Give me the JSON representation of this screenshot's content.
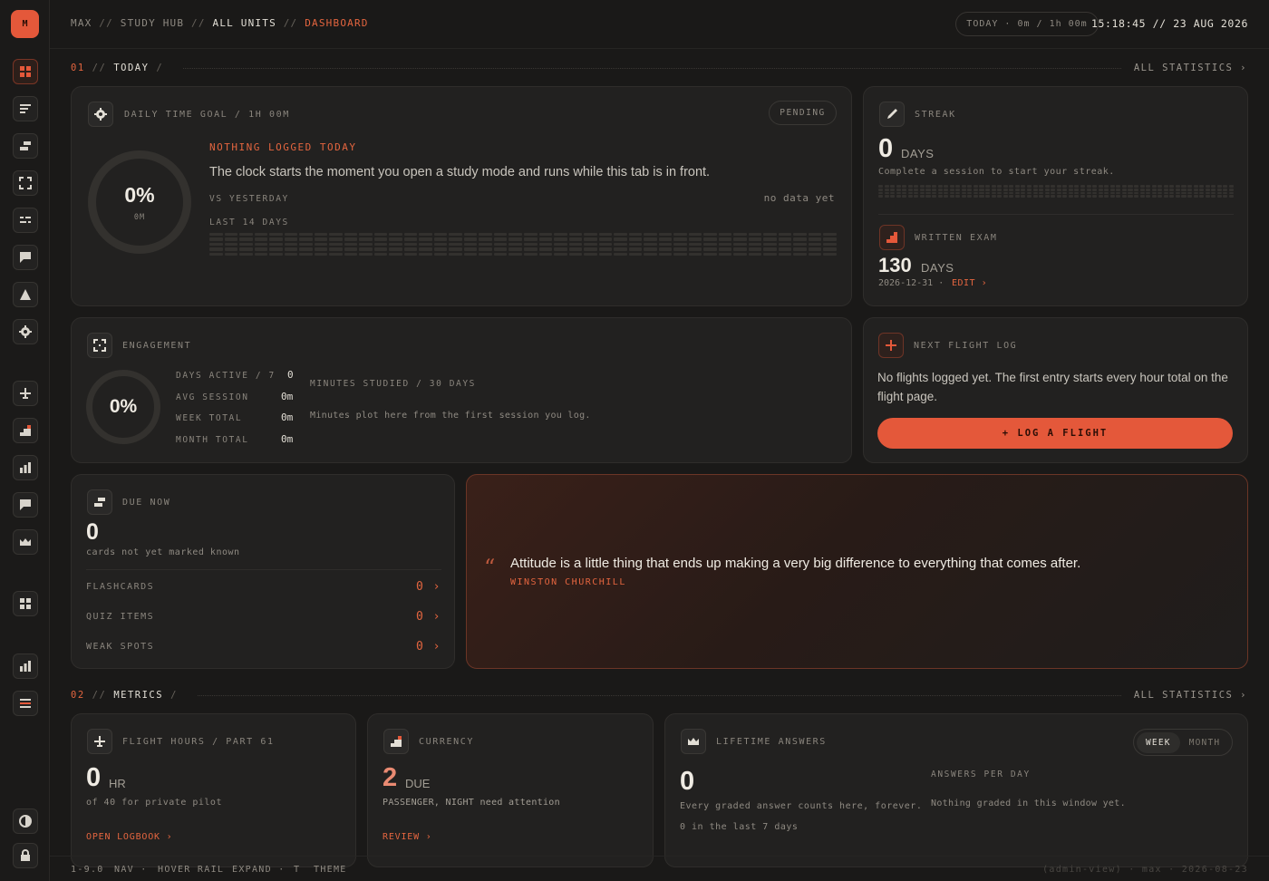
{
  "app": {
    "logo": "M"
  },
  "breadcrumb": {
    "user": "MAX",
    "hub": "STUDY HUB",
    "units": "ALL UNITS",
    "current": "DASHBOARD",
    "sep": "//"
  },
  "topbar": {
    "today_pill": "TODAY · 0m / 1h 00m",
    "clock": "15:18:45 // 23 AUG 2026"
  },
  "sections": {
    "today": {
      "num": "01",
      "title": "TODAY",
      "all": "ALL STATISTICS ›"
    },
    "metrics": {
      "num": "02",
      "title": "METRICS",
      "all": "ALL STATISTICS ›"
    }
  },
  "goal": {
    "label": "DAILY TIME GOAL / 1H 00M",
    "badge": "PENDING",
    "percent": "0%",
    "minutes": "0M",
    "progress": 0,
    "headline": "NOTHING LOGGED TODAY",
    "body": "The clock starts the moment you open a study mode and runs while this tab is in front.",
    "vs_label": "VS YESTERDAY",
    "vs_value": "no data yet",
    "last_label": "LAST 14 DAYS"
  },
  "streak": {
    "label": "STREAK",
    "value": "0",
    "unit": "DAYS",
    "sub": "Complete a session to start your streak."
  },
  "exam": {
    "label": "WRITTEN EXAM",
    "value": "130",
    "unit": "DAYS",
    "date": "2026-12-31 ·",
    "edit": "EDIT ›"
  },
  "engagement": {
    "label": "ENGAGEMENT",
    "percent": "0%",
    "progress": 0,
    "stats": [
      {
        "k": "DAYS ACTIVE / 7",
        "v": "0"
      },
      {
        "k": "AVG SESSION",
        "v": "0m"
      },
      {
        "k": "WEEK TOTAL",
        "v": "0m"
      },
      {
        "k": "MONTH TOTAL",
        "v": "0m"
      }
    ],
    "minutes_label": "MINUTES STUDIED / 30 DAYS",
    "minutes_empty": "Minutes plot here from the first session you log."
  },
  "flightlog": {
    "label": "NEXT FLIGHT LOG",
    "body": "No flights logged yet. The first entry starts every hour total on the flight page.",
    "button": "+ LOG A FLIGHT"
  },
  "due": {
    "label": "DUE NOW",
    "value": "0",
    "sub": "cards not yet marked known",
    "rows": [
      {
        "k": "FLASHCARDS",
        "v": "0 ›"
      },
      {
        "k": "QUIZ ITEMS",
        "v": "0 ›"
      },
      {
        "k": "WEAK SPOTS",
        "v": "0 ›"
      }
    ]
  },
  "quote": {
    "mark": "“",
    "text": "Attitude is a little thing that ends up making a very big difference to everything that comes after.",
    "author": "WINSTON CHURCHILL"
  },
  "hours": {
    "label": "FLIGHT HOURS / PART 61",
    "value": "0",
    "unit": "HR",
    "sub": "of 40 for private pilot",
    "link": "OPEN LOGBOOK ›"
  },
  "currency": {
    "label": "CURRENCY",
    "value": "2",
    "unit": "DUE",
    "sub": "PASSENGER, NIGHT need attention",
    "link": "REVIEW ›"
  },
  "lifetime": {
    "label": "LIFETIME ANSWERS",
    "value": "0",
    "sub": "Every graded answer counts here, forever.",
    "sub2": "0 in the last 7 days",
    "toggle": [
      "WEEK",
      "MONTH"
    ],
    "apd_label": "ANSWERS PER DAY",
    "apd_empty": "Nothing graded in this window yet."
  },
  "footer": {
    "version": "1-9.0",
    "nav": "NAV ·",
    "hover": "HOVER RAIL",
    "expand": "EXPAND ·",
    "key": "T",
    "theme": "THEME",
    "admin": "(admin-view) · max · 2026-08-23"
  },
  "colors": {
    "accent": "#e4583a",
    "bg": "#1a1918",
    "card": "#222120"
  }
}
